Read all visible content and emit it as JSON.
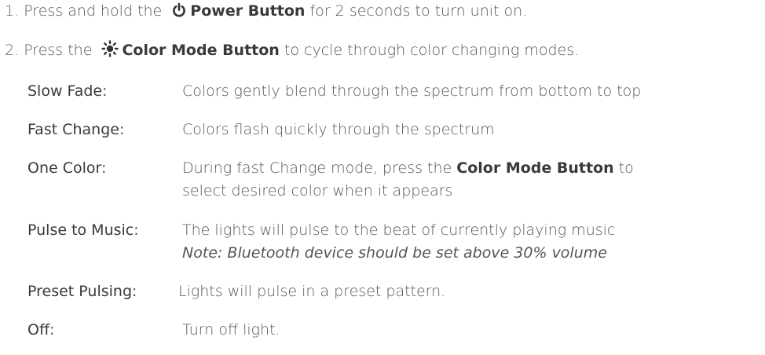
{
  "steps": [
    {
      "number": "1.",
      "pre": "Press and hold  the",
      "icon": "power-icon",
      "button": "Power Button",
      "post": "for 2 seconds to turn unit on."
    },
    {
      "number": "2.",
      "pre": "Press the",
      "icon": "sun-icon",
      "button": "Color Mode Button",
      "post": "to cycle through color changing modes."
    }
  ],
  "modes": [
    {
      "label": "Slow Fade",
      "desc": "Colors gently blend through the spectrum from bottom to top"
    },
    {
      "label": "Fast Change",
      "desc": "Colors flash quickly through the spectrum"
    },
    {
      "label": "One Color",
      "desc_pre": "During fast Change mode, press the",
      "desc_bold": "Color Mode Button",
      "desc_post": "to",
      "desc_line2": "select desired color when it appears"
    },
    {
      "label": "Pulse to Music",
      "desc": "The lights will pulse to the beat of currently playing music",
      "note": "Note: Bluetooth device should be set above 30% volume"
    },
    {
      "label": "Preset Pulsing",
      "desc": "Lights will pulse in a preset pattern."
    },
    {
      "label": "Off",
      "desc": "Turn off light."
    }
  ],
  "colon": ":",
  "colors": {
    "text": "#555555",
    "emphasis": "#3a3a3a",
    "background": "#ffffff"
  }
}
